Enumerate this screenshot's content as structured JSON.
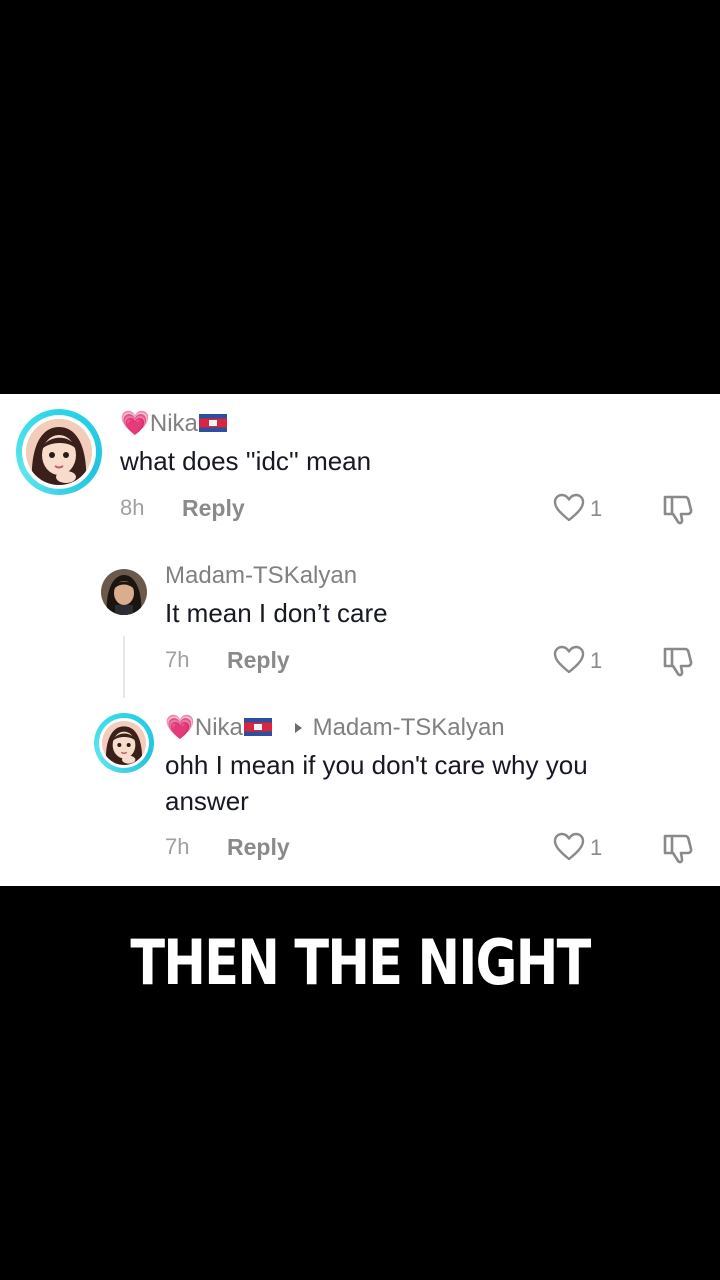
{
  "comments": [
    {
      "username_emoji": "💗",
      "username": "Nika",
      "text": "what does ''idc'' mean",
      "time": "8h",
      "reply_label": "Reply",
      "likes": "1"
    },
    {
      "username": "Madam-TSKalyan",
      "text": "It mean I don’t care",
      "time": "7h",
      "reply_label": "Reply",
      "likes": "1"
    },
    {
      "username_emoji": "💗",
      "username": "Nika",
      "reply_to": "Madam-TSKalyan",
      "text": "ohh I mean if you don't care why you answer",
      "time": "7h",
      "reply_label": "Reply",
      "likes": "1"
    }
  ],
  "caption": "THEN THE NIGHT",
  "colors": {
    "avatar_ring": "#2ad6e6",
    "username": "#808080",
    "text": "#161823"
  },
  "icons": [
    "heart-outline-icon",
    "thumbs-down-icon",
    "flag-icon",
    "caret-right-icon"
  ]
}
